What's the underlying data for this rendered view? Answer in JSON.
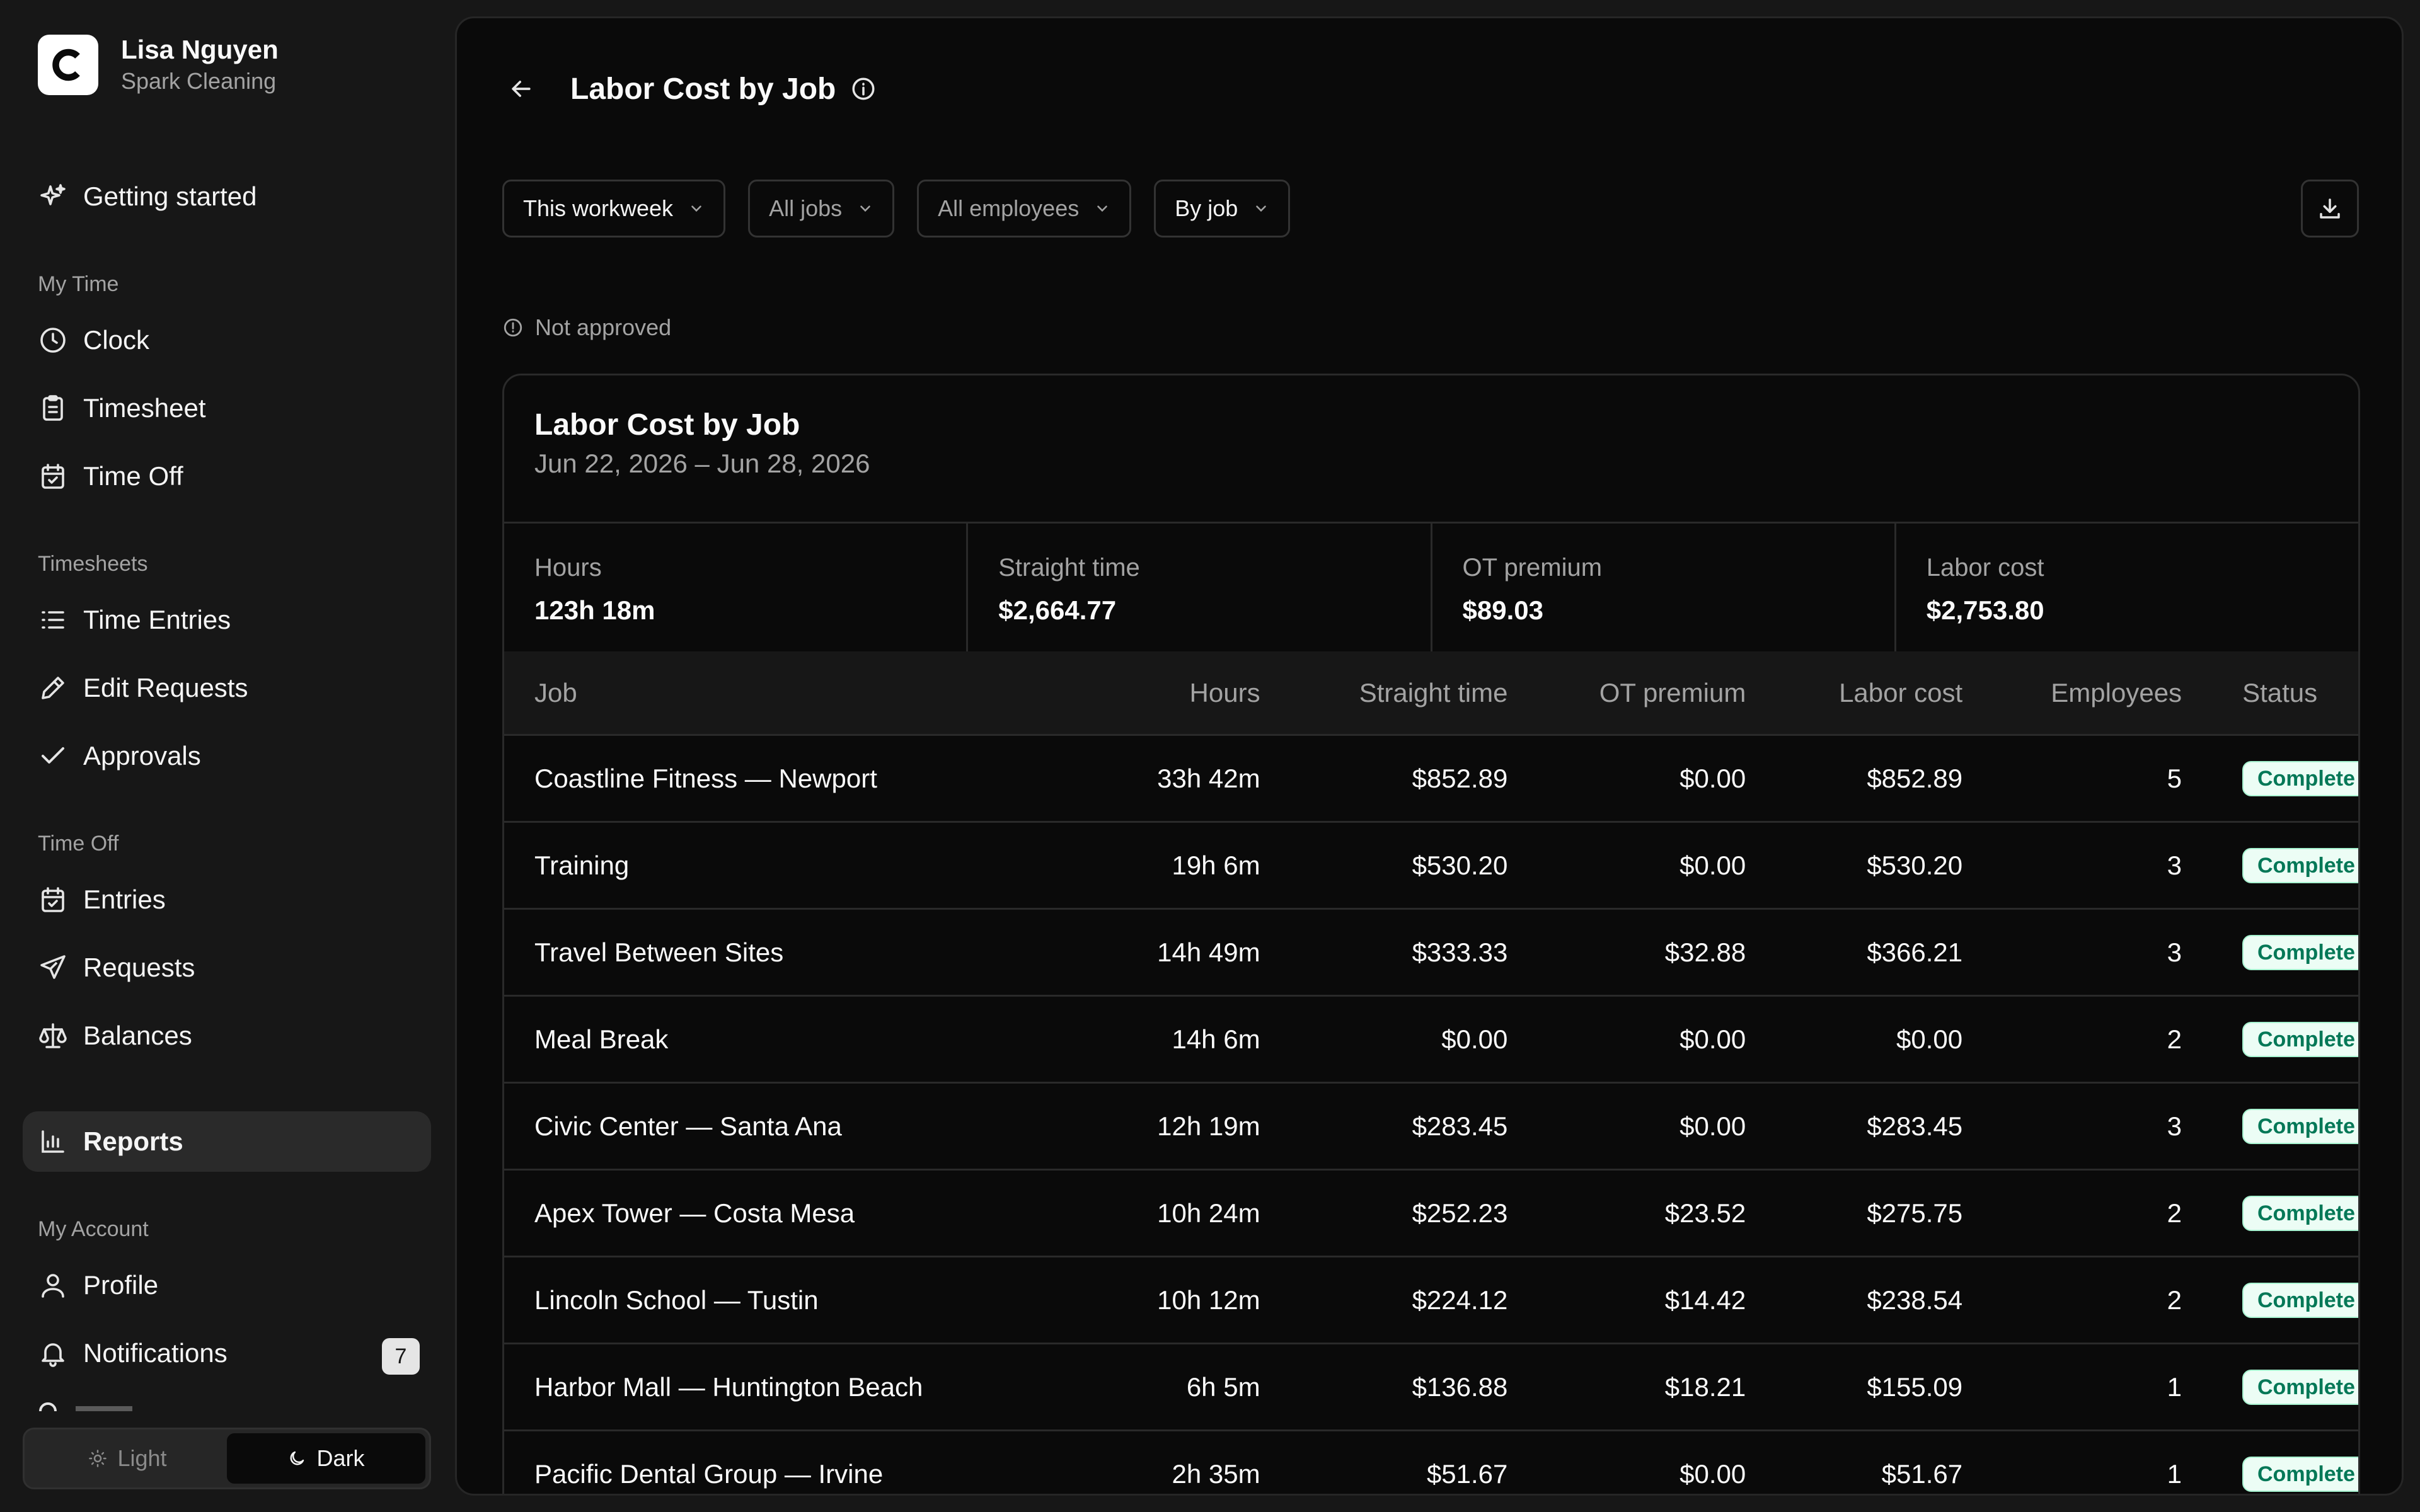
{
  "account": {
    "name": "Lisa Nguyen",
    "org": "Spark Cleaning"
  },
  "sidebar": {
    "getting_started": "Getting started",
    "sections": {
      "my_time": "My Time",
      "timesheets": "Timesheets",
      "time_off": "Time Off",
      "my_account": "My Account"
    },
    "items": {
      "clock": "Clock",
      "timesheet": "Timesheet",
      "time_off": "Time Off",
      "time_entries": "Time Entries",
      "edit_requests": "Edit Requests",
      "approvals": "Approvals",
      "entries": "Entries",
      "requests": "Requests",
      "balances": "Balances",
      "reports": "Reports",
      "profile": "Profile",
      "notifications": "Notifications"
    },
    "notifications_count": "7",
    "theme": {
      "light": "Light",
      "dark": "Dark",
      "selected": "Dark"
    }
  },
  "page": {
    "title": "Labor Cost by Job"
  },
  "filters": {
    "period": "This workweek",
    "jobs": "All jobs",
    "employees": "All employees",
    "group": "By job"
  },
  "approval_status": "Not approved",
  "report": {
    "title": "Labor Cost by Job",
    "date_range": "Jun 22, 2026 – Jun 28, 2026",
    "stats": [
      {
        "label": "Hours",
        "value": "123h 18m"
      },
      {
        "label": "Straight time",
        "value": "$2,664.77"
      },
      {
        "label": "OT premium",
        "value": "$89.03"
      },
      {
        "label": "Labor cost",
        "value": "$2,753.80"
      }
    ],
    "columns": [
      "Job",
      "Hours",
      "Straight time",
      "OT premium",
      "Labor cost",
      "Employees",
      "Status"
    ],
    "rows": [
      {
        "job": "Coastline Fitness — Newport",
        "hours": "33h 42m",
        "straight": "$852.89",
        "ot": "$0.00",
        "labor": "$852.89",
        "employees": "5",
        "status": "Complete"
      },
      {
        "job": "Training",
        "hours": "19h 6m",
        "straight": "$530.20",
        "ot": "$0.00",
        "labor": "$530.20",
        "employees": "3",
        "status": "Complete"
      },
      {
        "job": "Travel Between Sites",
        "hours": "14h 49m",
        "straight": "$333.33",
        "ot": "$32.88",
        "labor": "$366.21",
        "employees": "3",
        "status": "Complete"
      },
      {
        "job": "Meal Break",
        "hours": "14h 6m",
        "straight": "$0.00",
        "ot": "$0.00",
        "labor": "$0.00",
        "employees": "2",
        "status": "Complete"
      },
      {
        "job": "Civic Center — Santa Ana",
        "hours": "12h 19m",
        "straight": "$283.45",
        "ot": "$0.00",
        "labor": "$283.45",
        "employees": "3",
        "status": "Complete"
      },
      {
        "job": "Apex Tower — Costa Mesa",
        "hours": "10h 24m",
        "straight": "$252.23",
        "ot": "$23.52",
        "labor": "$275.75",
        "employees": "2",
        "status": "Complete"
      },
      {
        "job": "Lincoln School — Tustin",
        "hours": "10h 12m",
        "straight": "$224.12",
        "ot": "$14.42",
        "labor": "$238.54",
        "employees": "2",
        "status": "Complete"
      },
      {
        "job": "Harbor Mall — Huntington Beach",
        "hours": "6h 5m",
        "straight": "$136.88",
        "ot": "$18.21",
        "labor": "$155.09",
        "employees": "1",
        "status": "Complete"
      },
      {
        "job": "Pacific Dental Group — Irvine",
        "hours": "2h 35m",
        "straight": "$51.67",
        "ot": "$0.00",
        "labor": "$51.67",
        "employees": "1",
        "status": "Complete"
      }
    ]
  },
  "colors": {
    "background": "#171717",
    "panel": "#0a0a0a",
    "status_complete_bg": "#ecfdf5",
    "status_complete_text": "#047857"
  }
}
